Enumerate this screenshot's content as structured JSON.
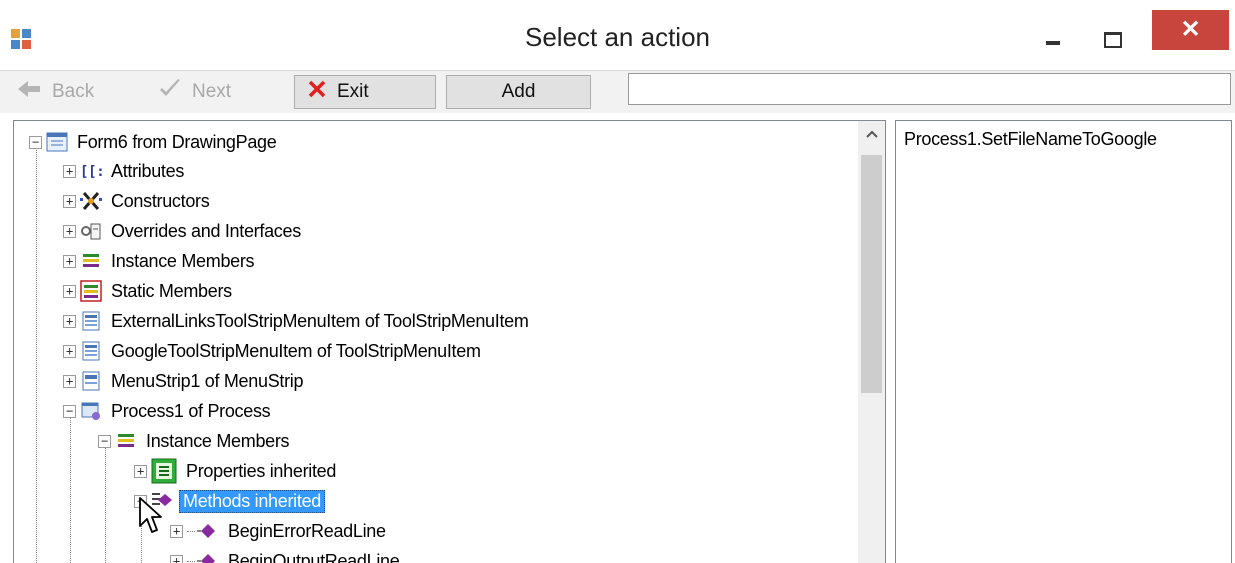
{
  "window": {
    "title": "Select an action",
    "close_label": "✕"
  },
  "toolbar": {
    "back_label": "Back",
    "next_label": "Next",
    "exit_label": "Exit",
    "add_label": "Add",
    "input_value": ""
  },
  "tree": {
    "root": "Form6 from DrawingPage",
    "items": [
      {
        "label": "Attributes",
        "icon": "attributes-icon"
      },
      {
        "label": "Constructors",
        "icon": "constructors-icon"
      },
      {
        "label": "Overrides and Interfaces",
        "icon": "interfaces-icon"
      },
      {
        "label": "Instance Members",
        "icon": "instance-members-icon"
      },
      {
        "label": "Static Members",
        "icon": "static-members-icon"
      },
      {
        "label": "ExternalLinksToolStripMenuItem of ToolStripMenuItem",
        "icon": "menu-item-icon"
      },
      {
        "label": "GoogleToolStripMenuItem of ToolStripMenuItem",
        "icon": "menu-item-icon"
      },
      {
        "label": "MenuStrip1 of MenuStrip",
        "icon": "menu-strip-icon"
      },
      {
        "label": "Process1 of Process",
        "icon": "process-icon"
      }
    ],
    "process_children": {
      "instance_members": "Instance Members",
      "properties_inherited": "Properties inherited",
      "methods_inherited": "Methods inherited",
      "methods": [
        "BeginErrorReadLine",
        "BeginOutputReadLine"
      ]
    }
  },
  "right_panel": {
    "text": "Process1.SetFileNameToGoogle"
  }
}
